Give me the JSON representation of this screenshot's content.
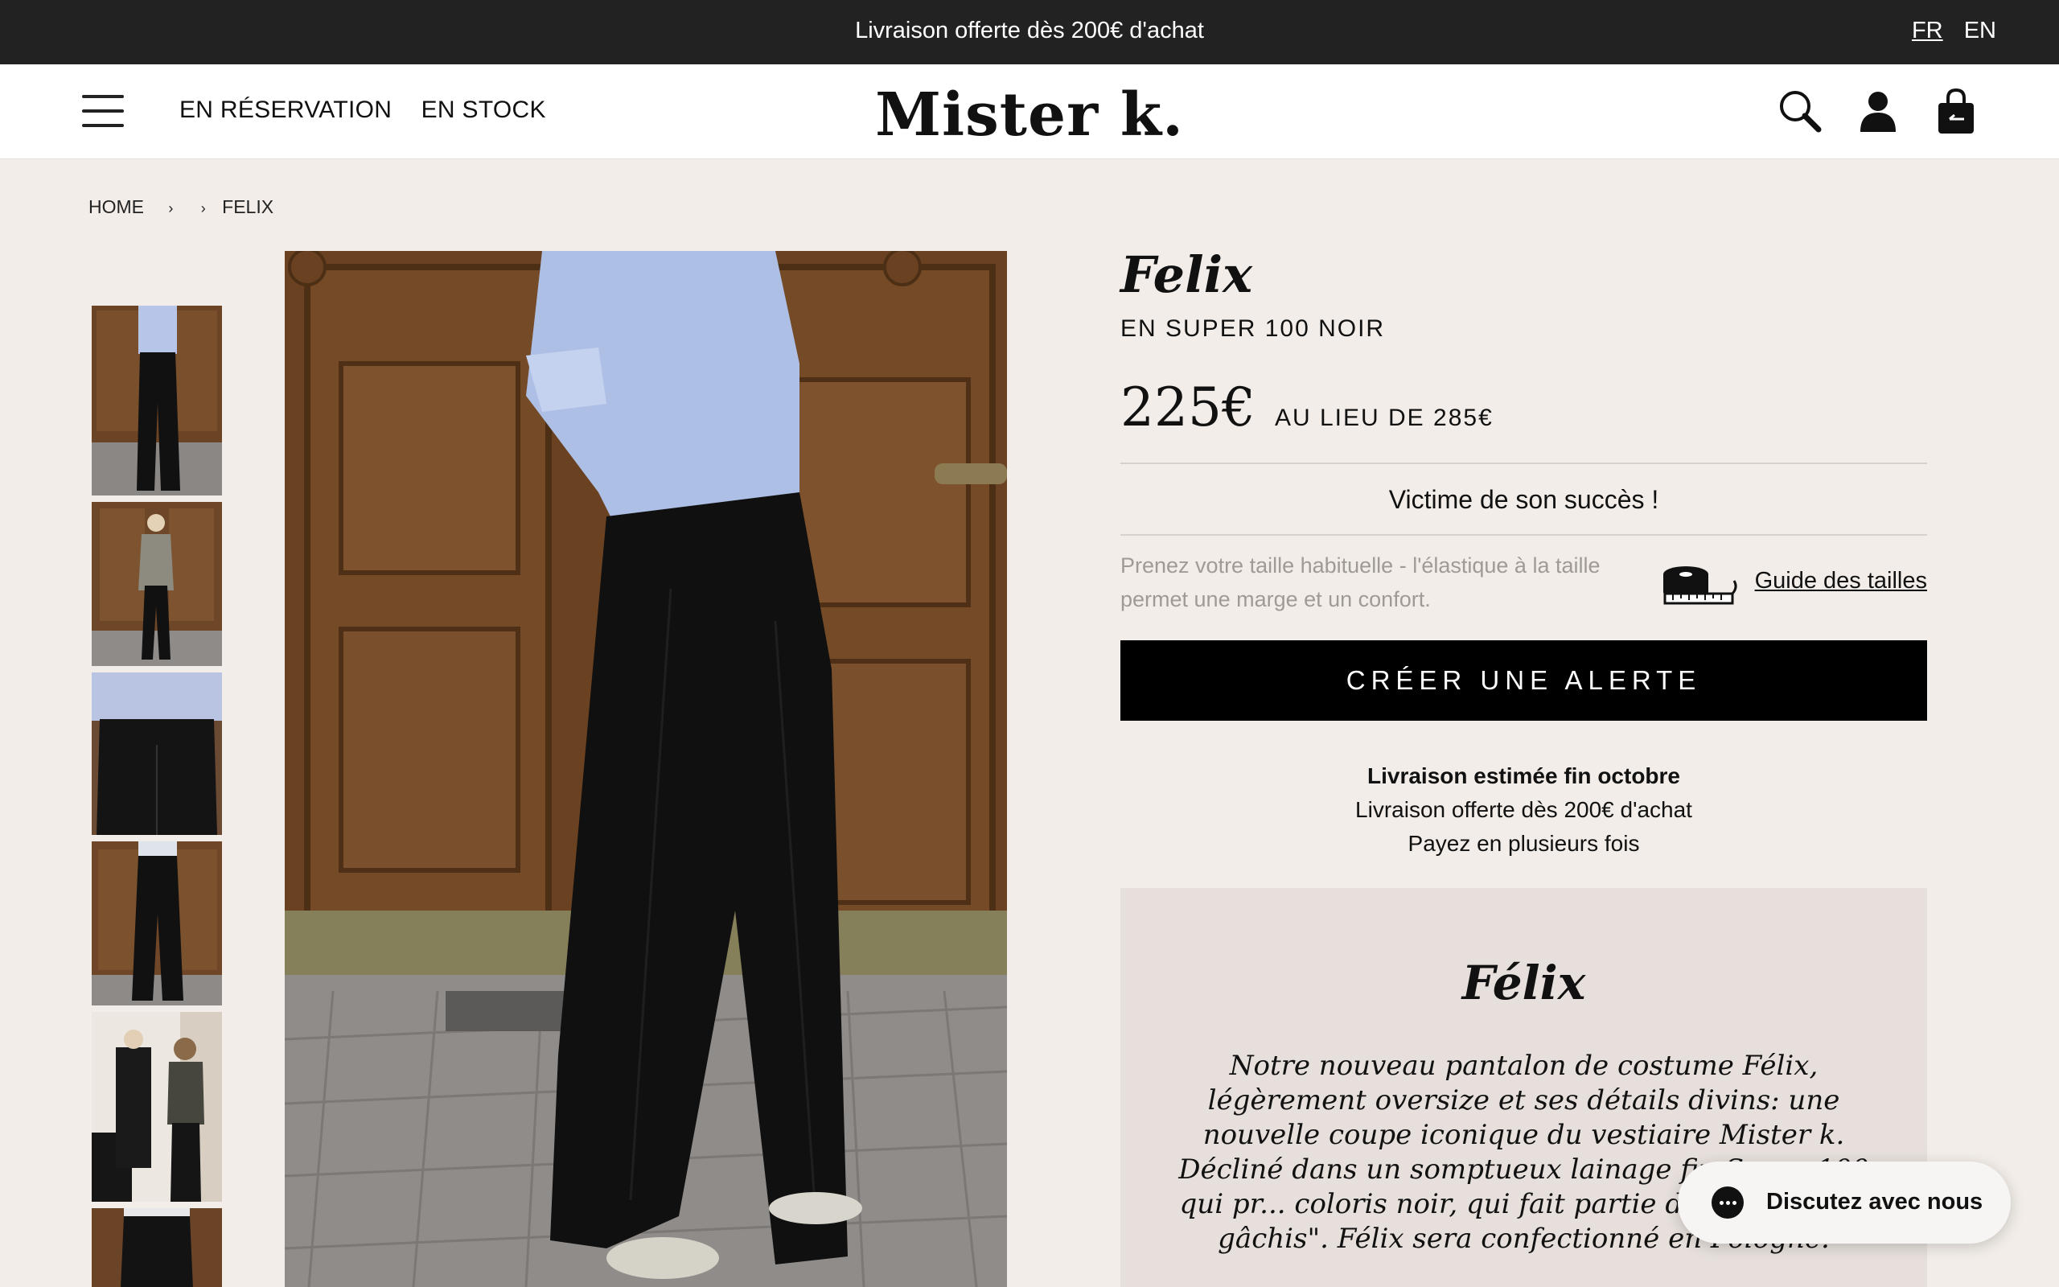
{
  "topbar": {
    "promo": "Livraison offerte dès 200€ d'achat",
    "languages": [
      {
        "code": "FR",
        "active": true
      },
      {
        "code": "EN",
        "active": false
      }
    ]
  },
  "header": {
    "menu_icon": "hamburger-menu-icon",
    "nav": [
      "EN RÉSERVATION",
      "EN STOCK"
    ],
    "logo": "Mister k.",
    "icons": [
      "search-icon",
      "user-icon",
      "bag-icon"
    ]
  },
  "breadcrumb": {
    "home": "HOME",
    "sep": "›",
    "current": "FELIX"
  },
  "gallery": {
    "thumbnails": [
      "thumb-1",
      "thumb-2",
      "thumb-3",
      "thumb-4",
      "thumb-5",
      "thumb-6"
    ]
  },
  "product": {
    "title": "Felix",
    "subtitle": "EN SUPER 100 NOIR",
    "price": "225€",
    "old_price": "AU LIEU DE 285€",
    "success": "Victime de son succès !",
    "size_note": "Prenez votre taille habituelle - l'élastique à la taille permet une marge et un confort.",
    "size_guide": "Guide des tailles",
    "cta": "CRÉER UNE ALERTE",
    "delivery_estimate": "Livraison estimée fin octobre",
    "free_shipping": "Livraison offerte dès 200€ d'achat",
    "payment": "Payez en plusieurs fois"
  },
  "description": {
    "title": "Félix",
    "text": "Notre nouveau pantalon de costume Félix, légèrement oversize et ses détails divins: une nouvelle coupe iconique du vestiaire Mister k. Décliné dans un somptueux lainage fin Super 100 qui pr... coloris noir, qui fait partie de notre eng... gâchis\". Félix sera confectionné en Pologne."
  },
  "chat": {
    "label": "Discutez avec nous"
  },
  "colors": {
    "topbar": "#222222",
    "page_bg": "#f2ede8",
    "cta": "#000000",
    "desc_box": "#e6dfdb"
  }
}
